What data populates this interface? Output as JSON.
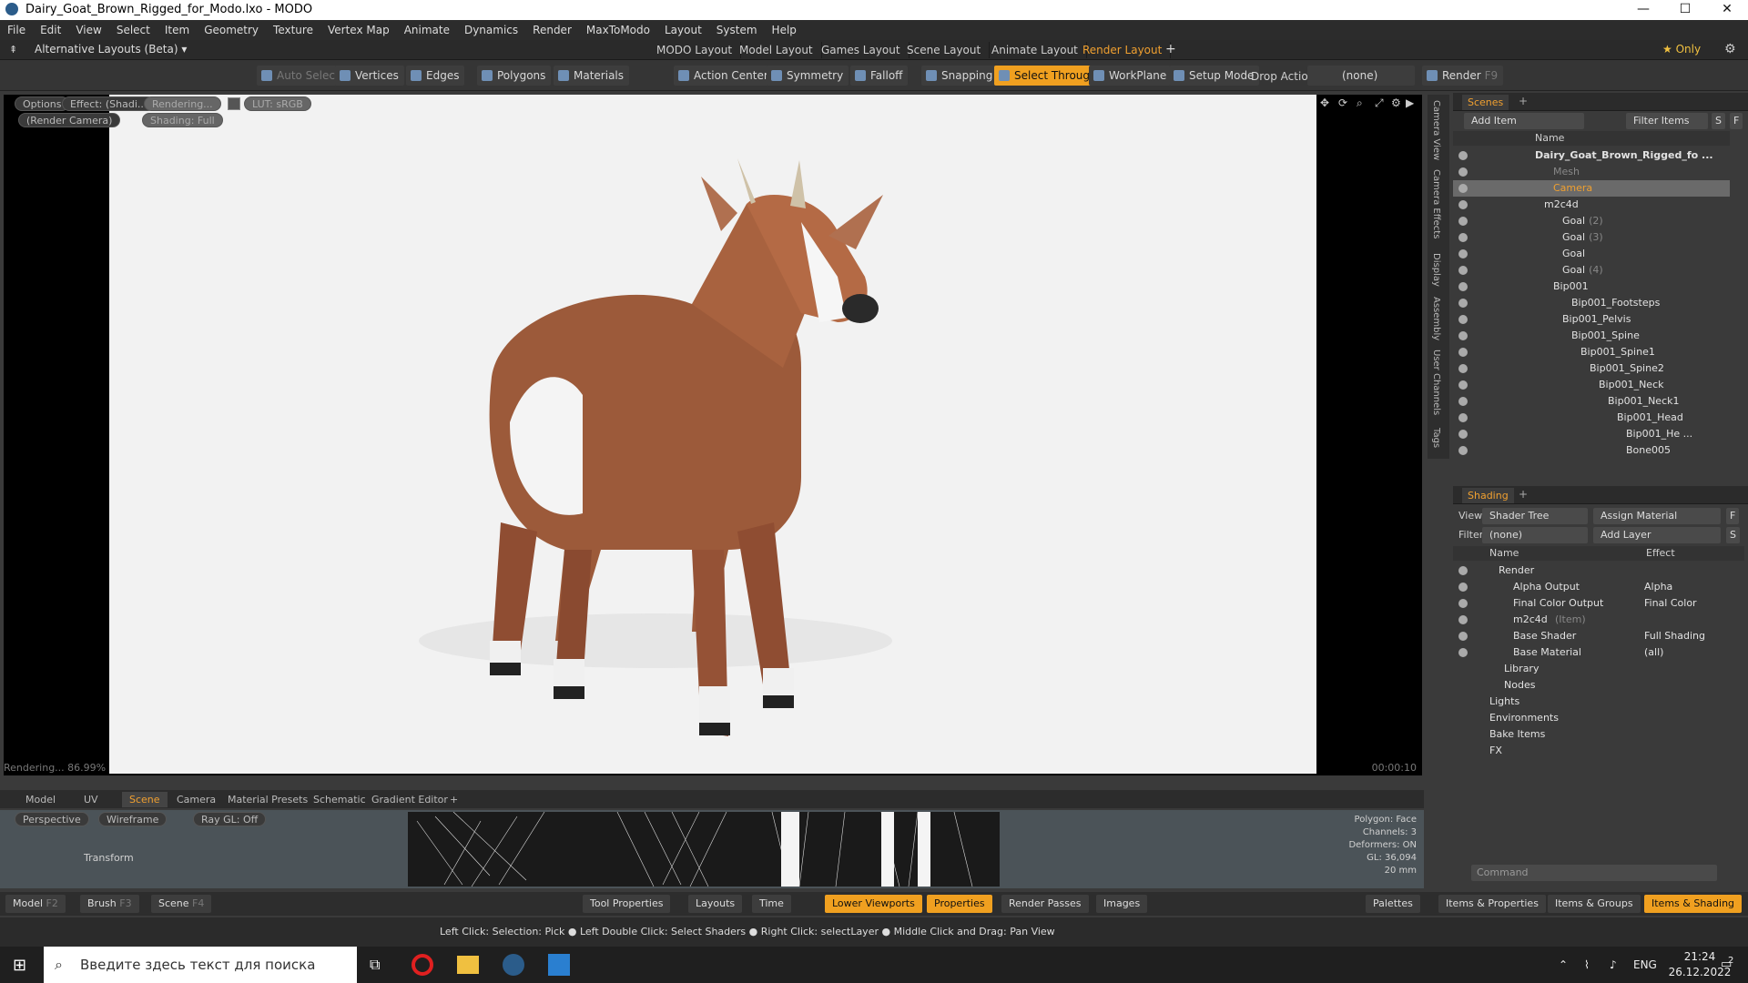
{
  "window": {
    "title": "Dairy_Goat_Brown_Rigged_for_Modo.lxo - MODO",
    "min": "—",
    "max": "☐",
    "close": "✕"
  },
  "menu": [
    "File",
    "Edit",
    "View",
    "Select",
    "Item",
    "Geometry",
    "Texture",
    "Vertex Map",
    "Animate",
    "Dynamics",
    "Render",
    "MaxToModo",
    "Layout",
    "System",
    "Help"
  ],
  "layout_bar": {
    "alt_layouts": "Alternative Layouts (Beta) ▾",
    "tabs": [
      "MODO Layout",
      "Model Layout",
      "Games Layout",
      "Scene Layout",
      "Animate Layout",
      "Render Layout"
    ],
    "active_tab": "Render Layout",
    "add": "+",
    "only": "★ Only"
  },
  "toolbar": {
    "auto_select": "Auto Select",
    "vertices": "Vertices",
    "edges": "Edges",
    "polygons": "Polygons",
    "materials": "Materials",
    "action_center": "Action Center",
    "symmetry": "Symmetry",
    "falloff": "Falloff",
    "snapping": "Snapping",
    "select_through": "Select Through",
    "workplane": "WorkPlane",
    "setup_mode": "Setup Mode",
    "drop_action": "Drop Action",
    "drop_value": "(none)",
    "render": "Render",
    "render_key": "F9"
  },
  "viewport": {
    "options": "Options",
    "effect": "Effect: (Shadi...",
    "rendering": "Rendering...",
    "lut": "LUT: sRGB",
    "camera": "(Render Camera)",
    "shading": "Shading: Full",
    "status": "Rendering... 86.99%",
    "time": "00:00:10"
  },
  "side_tabs": [
    "Camera View",
    "Camera Effects",
    "Display",
    "Assembly",
    "User Channels",
    "Tags"
  ],
  "scenes": {
    "tab": "Scenes",
    "add_item": "Add Item",
    "filter": "Filter Items",
    "s": "S",
    "f": "F",
    "col_name": "Name",
    "rows": [
      {
        "label": "Dairy_Goat_Brown_Rigged_fo ...",
        "suffix": "",
        "indent": 0,
        "bold": true
      },
      {
        "label": "Mesh",
        "suffix": "",
        "indent": 2,
        "dim": true
      },
      {
        "label": "Camera",
        "suffix": "",
        "indent": 2,
        "sel": true
      },
      {
        "label": "m2c4d",
        "suffix": "",
        "indent": 1
      },
      {
        "label": "Goal",
        "suffix": "(2)",
        "indent": 3
      },
      {
        "label": "Goal",
        "suffix": "(3)",
        "indent": 3
      },
      {
        "label": "Goal",
        "suffix": "",
        "indent": 3
      },
      {
        "label": "Goal",
        "suffix": "(4)",
        "indent": 3
      },
      {
        "label": "Bip001",
        "suffix": "",
        "indent": 2
      },
      {
        "label": "Bip001_Footsteps",
        "suffix": "",
        "indent": 4
      },
      {
        "label": "Bip001_Pelvis",
        "suffix": "",
        "indent": 3
      },
      {
        "label": "Bip001_Spine",
        "suffix": "",
        "indent": 4
      },
      {
        "label": "Bip001_Spine1",
        "suffix": "",
        "indent": 5
      },
      {
        "label": "Bip001_Spine2",
        "suffix": "",
        "indent": 6
      },
      {
        "label": "Bip001_Neck",
        "suffix": "",
        "indent": 7
      },
      {
        "label": "Bip001_Neck1",
        "suffix": "",
        "indent": 8
      },
      {
        "label": "Bip001_Head",
        "suffix": "",
        "indent": 9
      },
      {
        "label": "Bip001_He ...",
        "suffix": "",
        "indent": 10
      },
      {
        "label": "Bone005",
        "suffix": "",
        "indent": 10
      }
    ]
  },
  "shading": {
    "tab": "Shading",
    "view_label": "View",
    "view_value": "Shader Tree",
    "assign_material": "Assign Material",
    "filter_label": "Filter",
    "filter_value": "(none)",
    "add_layer": "Add Layer",
    "f": "F",
    "s": "S",
    "col_name": "Name",
    "col_effect": "Effect",
    "rows": [
      {
        "label": "Render",
        "effect": ""
      },
      {
        "label": "Alpha Output",
        "effect": "Alpha"
      },
      {
        "label": "Final Color Output",
        "effect": "Final Color"
      },
      {
        "label": "m2c4d",
        "suffix": "(Item)",
        "effect": ""
      },
      {
        "label": "Base Shader",
        "effect": "Full Shading"
      },
      {
        "label": "Base Material",
        "effect": "(all)"
      },
      {
        "label": "Library",
        "effect": ""
      },
      {
        "label": "Nodes",
        "effect": ""
      },
      {
        "label": "Lights",
        "effect": ""
      },
      {
        "label": "Environments",
        "effect": ""
      },
      {
        "label": "Bake Items",
        "effect": ""
      },
      {
        "label": "FX",
        "effect": ""
      }
    ],
    "command": "Command"
  },
  "lower_tabs": [
    "Model",
    "UV",
    "Scene",
    "Camera",
    "Material Presets",
    "Schematic",
    "Gradient Editor"
  ],
  "lower_active": "Scene",
  "lower_vp": {
    "perspective": "Perspective",
    "wireframe": "Wireframe",
    "raygl": "Ray GL: Off",
    "transform": "Transform",
    "info_lines": [
      "Polygon: Face",
      "Channels: 3",
      "Deformers: ON",
      "GL: 36,094",
      "20 mm"
    ]
  },
  "bottom_bar": {
    "model": "Model",
    "model_key": "F2",
    "brush": "Brush",
    "brush_key": "F3",
    "scene": "Scene",
    "scene_key": "F4",
    "tool_properties": "Tool Properties",
    "layouts": "Layouts",
    "time": "Time",
    "lower_viewports": "Lower Viewports",
    "properties": "Properties",
    "render_passes": "Render Passes",
    "images": "Images",
    "palettes": "Palettes",
    "items_properties": "Items & Properties",
    "items_groups": "Items & Groups",
    "items_shading": "Items & Shading"
  },
  "hint": "Left Click: Selection: Pick ● Left Double Click: Select Shaders ● Right Click: selectLayer ● Middle Click and Drag: Pan View",
  "taskbar": {
    "search": "Введите здесь текст для поиска",
    "lang": "ENG",
    "time": "21:24",
    "date": "26.12.2022",
    "notif": "2"
  }
}
